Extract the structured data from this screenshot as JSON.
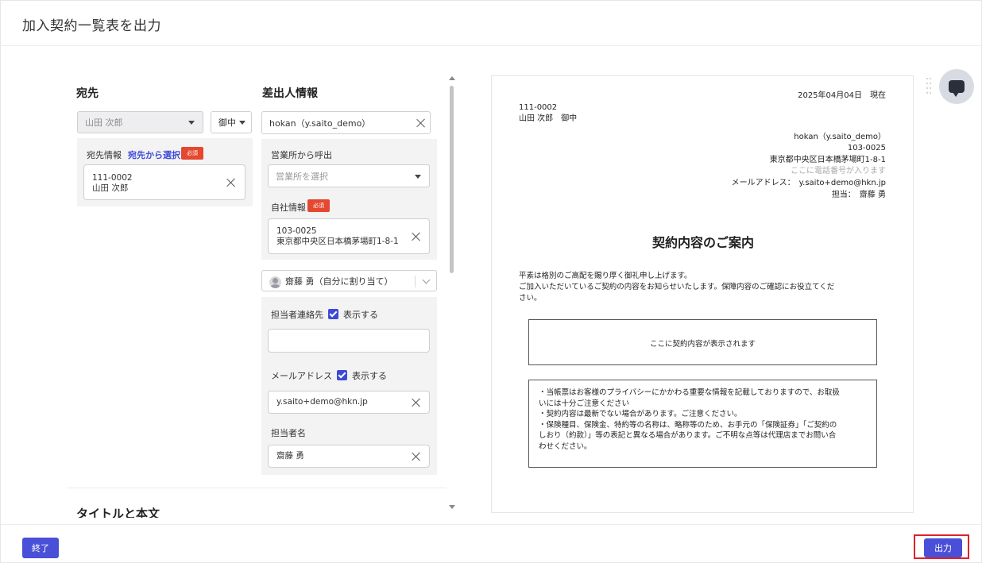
{
  "header": {
    "title": "加入契約一覧表を出力"
  },
  "recipient": {
    "heading": "宛先",
    "name_select": "山田 次郎",
    "honorific_select": "御中",
    "info_label": "宛先情報",
    "select_link": "宛先から選択",
    "required_badge": "必須",
    "address_line1": "111-0002",
    "address_line2": "山田 次郎"
  },
  "sender": {
    "heading": "差出人情報",
    "account_select": "hokan（y.saito_demo）",
    "office_label": "営業所から呼出",
    "office_placeholder": "営業所を選択",
    "company_label": "自社情報",
    "required_badge": "必須",
    "company_line1": "103-0025",
    "company_line2": "東京都中央区日本橋茅場町1-8-1",
    "assignee_select": "齋藤 勇（自分に割り当て）",
    "contact_label": "担当者連絡先",
    "contact_show": "表示する",
    "contact_value": "",
    "email_label": "メールアドレス",
    "email_show": "表示する",
    "email_value": "y.saito+demo@hkn.jp",
    "staff_label": "担当者名",
    "staff_value": "齋藤 勇"
  },
  "next_section": {
    "heading": "タイトルと本文"
  },
  "preview": {
    "date": "2025年04月04日　現在",
    "to_line1": "111-0002",
    "to_line2": "山田 次郎　御中",
    "from_line1": "hokan（y.saito_demo）",
    "from_line2": "103-0025",
    "from_line3": "東京都中央区日本橋茅場町1-8-1",
    "from_phone_placeholder": "ここに電話番号が入ります",
    "from_email": "メールアドレス：　y.saito+demo@hkn.jp",
    "from_staff": "担当：　齋藤 勇",
    "title": "契約内容のご案内",
    "body_line1": "平素は格別のご高配を賜り厚く御礼申し上げます。",
    "body_line2": "ご加入いただいているご契約の内容をお知らせいたします。保障内容のご確認にお役立てくだ",
    "body_line3": "さい。",
    "contract_placeholder": "ここに契約内容が表示されます",
    "notes": [
      "・当帳票はお客様のプライバシーにかかわる重要な情報を記載しておりますので、お取扱",
      "いには十分ご注意ください",
      "・契約内容は最新でない場合があります。ご注意ください。",
      "・保険種目、保険金、特約等の名称は、略称等のため、お手元の「保険証券」「ご契約の",
      "しおり（約款）」等の表記と異なる場合があります。ご不明な点等は代理店までお問い合",
      "わせください。"
    ]
  },
  "footer": {
    "end_label": "終了",
    "output_label": "出力"
  }
}
